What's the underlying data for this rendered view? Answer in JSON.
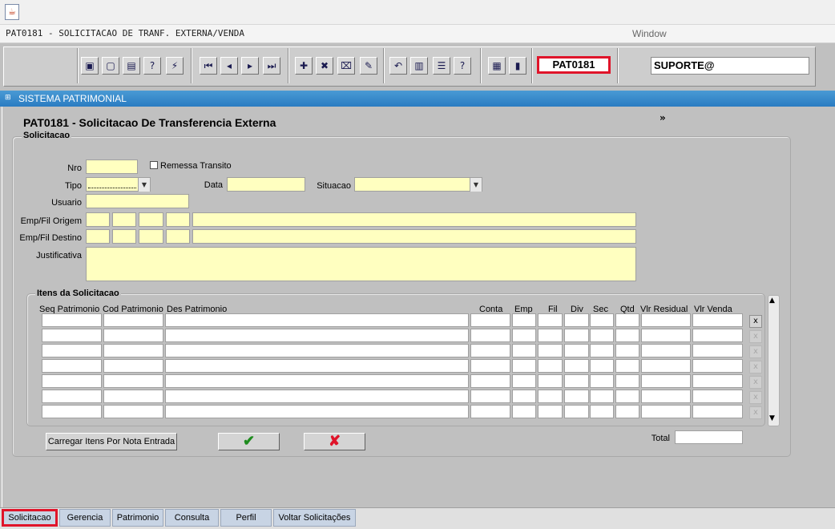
{
  "window": {
    "app_icon": "java-icon",
    "title": "PAT0181 - SOLICITACAO DE TRANF. EXTERNA/VENDA",
    "window_menu": "Window"
  },
  "toolbar": {
    "icons": [
      "save-icon",
      "window-icon",
      "print-icon",
      "query-icon",
      "execute-query-icon",
      "first-record-icon",
      "previous-record-icon",
      "next-record-icon",
      "last-record-icon",
      "insert-record-icon",
      "delete-record-icon",
      "clear-icon",
      "edit-icon",
      "undo-icon",
      "copy-icon",
      "list-values-icon",
      "help-icon",
      "menu-icon",
      "exit-icon"
    ],
    "form_code": "PAT0181",
    "user": "SUPORTE@"
  },
  "system_bar": {
    "label": "SISTEMA PATRIMONIAL"
  },
  "form": {
    "title": "PAT0181 - Solicitacao De Transferencia Externa",
    "chevron": "»",
    "section_label": "Solicitacao",
    "labels": {
      "nro": "Nro",
      "remessa": "Remessa Transito",
      "tipo": "Tipo",
      "data": "Data",
      "situacao": "Situacao",
      "usuario": "Usuario",
      "origem": "Emp/Fil Origem",
      "destino": "Emp/Fil Destino",
      "justificativa": "Justificativa"
    },
    "values": {
      "nro": "",
      "tipo": "",
      "data": "",
      "situacao": "",
      "usuario": "",
      "justificativa": ""
    },
    "remessa_checked": false
  },
  "items": {
    "section_label": "Itens da Solicitacao",
    "columns": [
      "Seq Patrimonio",
      "Cod Patrimonio",
      "Des Patrimonio",
      "Conta",
      "Emp",
      "Fil",
      "Div",
      "Sec",
      "Qtd",
      "Vlr Residual",
      "Vlr Venda"
    ],
    "row_count": 7,
    "delete_label": "x",
    "total_label": "Total",
    "total_value": ""
  },
  "buttons": {
    "carregar": "Carregar Itens Por Nota Entrada",
    "ok_icon": "green-check-icon",
    "cancel_icon": "red-x-icon"
  },
  "tabs": [
    "Solicitacao",
    "Gerencia",
    "Patrimonio",
    "Consulta",
    "Perfil",
    "Voltar Solicitações"
  ],
  "active_tab": "Solicitacao",
  "colors": {
    "field_bg": "#ffffc0",
    "highlight": "#e0142a",
    "system_bar": "#2a7cc2"
  }
}
